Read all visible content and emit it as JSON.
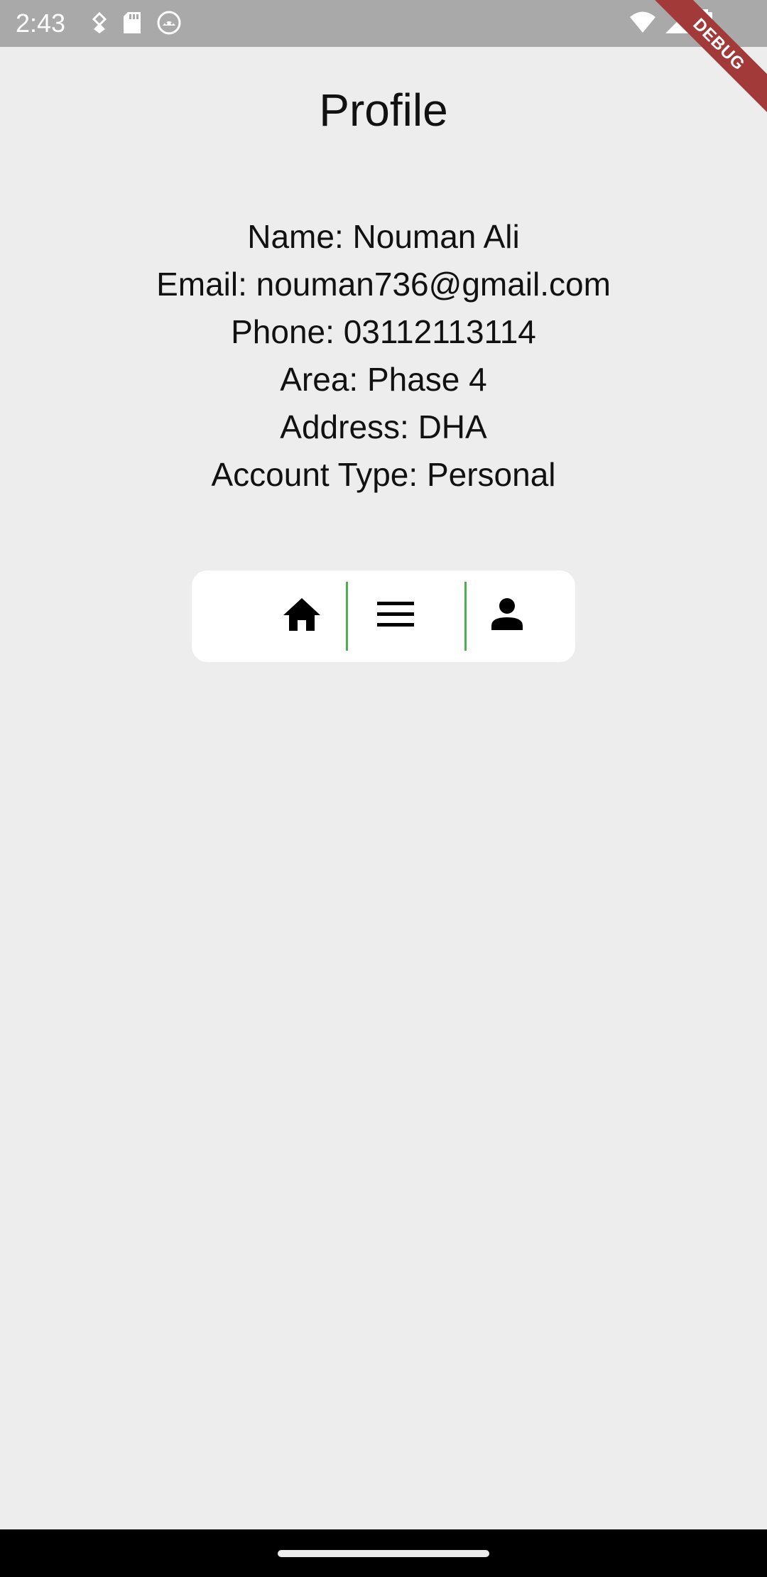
{
  "status_bar": {
    "time": "2:43",
    "icons": [
      "notification-app-icon",
      "sd-card-icon",
      "android-debug-icon",
      "wifi-icon",
      "signal-icon",
      "battery-icon"
    ]
  },
  "debug_banner": {
    "label": "DEBUG"
  },
  "profile": {
    "title": "Profile",
    "name_line": "Name: Nouman Ali",
    "email_line": "Email: nouman736@gmail.com",
    "phone_line": "Phone: 03112113114",
    "area_line": "Area: Phase 4",
    "address_line": "Address: DHA",
    "account_type_line": "Account Type: Personal"
  },
  "nav": {
    "items": [
      {
        "icon": "home-icon"
      },
      {
        "icon": "menu-icon"
      },
      {
        "icon": "person-icon"
      }
    ],
    "divider_color": "#4caf50"
  },
  "colors": {
    "background": "#ededed",
    "status_bar": "#a9a9a9",
    "card": "#ffffff",
    "debug_ribbon": "#a33a3a"
  }
}
